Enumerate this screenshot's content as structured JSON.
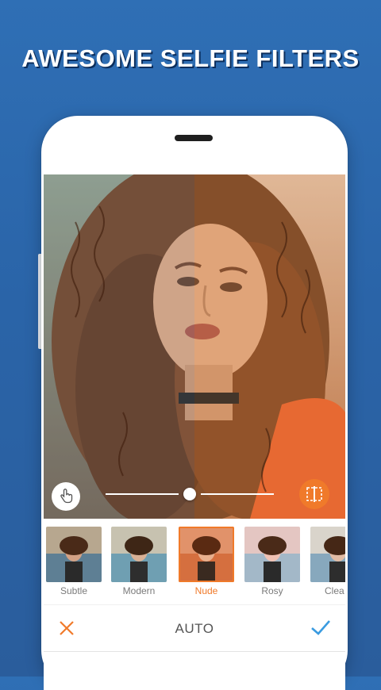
{
  "headline": "AWESOME SELFIE FILTERS",
  "editor": {
    "image_description_icon": "portrait-photo",
    "slider_value": 0.45,
    "hand_icon": "hand-pointer-icon",
    "compare_icon": "compare-split-icon"
  },
  "filters": [
    {
      "label": "Subtle",
      "selected": false
    },
    {
      "label": "Modern",
      "selected": false
    },
    {
      "label": "Nude",
      "selected": true
    },
    {
      "label": "Rosy",
      "selected": false
    },
    {
      "label": "Clea",
      "selected": false
    }
  ],
  "actionbar": {
    "title": "AUTO",
    "cancel_icon": "close-icon",
    "confirm_icon": "check-icon"
  },
  "colors": {
    "accent": "#f07a2a",
    "confirm": "#3a9be0",
    "background": "#2f6fb5"
  }
}
